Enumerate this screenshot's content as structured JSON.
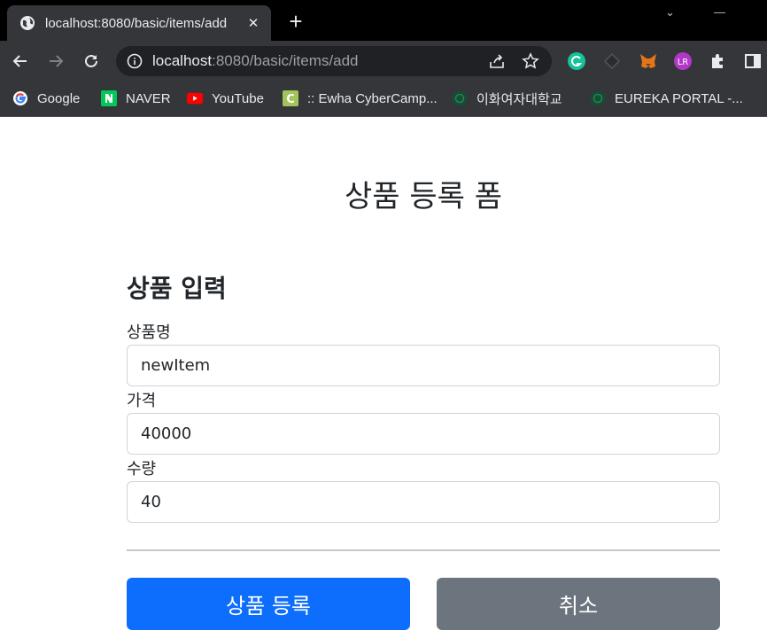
{
  "browser": {
    "tab": {
      "title": "localhost:8080/basic/items/add",
      "close": "✕"
    },
    "new_tab": "+",
    "window_controls": {
      "chevron": "⌄",
      "minimize": "—"
    },
    "address": {
      "host": "localhost",
      "path": ":8080/basic/items/add"
    },
    "bookmarks": [
      {
        "label": "Google",
        "icon": "google-icon",
        "color": "#4285f4"
      },
      {
        "label": "NAVER",
        "icon": "naver-icon",
        "color": "#03c75a"
      },
      {
        "label": "YouTube",
        "icon": "youtube-icon",
        "color": "#ff0000"
      },
      {
        "label": ":: Ewha CyberCamp...",
        "icon": "cybercamp-icon",
        "color": "#a3c35b"
      },
      {
        "label": "이화여자대학교",
        "icon": "ewha-icon",
        "color": "#0f5132"
      },
      {
        "label": "EUREKA PORTAL -...",
        "icon": "eureka-icon",
        "color": "#0f5132"
      }
    ]
  },
  "page": {
    "title": "상품 등록 폼",
    "section_title": "상품 입력",
    "fields": {
      "item_name": {
        "label": "상품명",
        "value": "newItem"
      },
      "price": {
        "label": "가격",
        "value": "40000"
      },
      "quantity": {
        "label": "수량",
        "value": "40"
      }
    },
    "buttons": {
      "submit": "상품 등록",
      "cancel": "취소"
    },
    "colors": {
      "primary": "#0d6efd",
      "secondary": "#6c757d"
    }
  }
}
